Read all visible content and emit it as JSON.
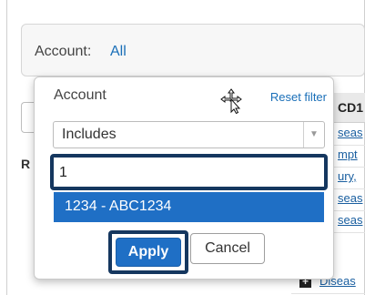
{
  "filter_bar": {
    "label": "Account:",
    "value": "All"
  },
  "popup": {
    "title": "Account",
    "reset_label": "Reset filter",
    "operator": {
      "selected": "Includes",
      "arrow_icon": "triangle-down"
    },
    "search": {
      "value": "1"
    },
    "suggestion": "1234 - ABC1234",
    "apply_label": "Apply",
    "cancel_label": "Cancel"
  },
  "background": {
    "column_header": "CD1",
    "rows": [
      "seas",
      "mpt",
      "ury,",
      "seas",
      "seas",
      "Diseas"
    ],
    "left_letter": "R",
    "bottom_text": "S..."
  },
  "colors": {
    "accent": "#1f6fc5",
    "focus": "#15375f",
    "link": "#1a6fb8"
  }
}
